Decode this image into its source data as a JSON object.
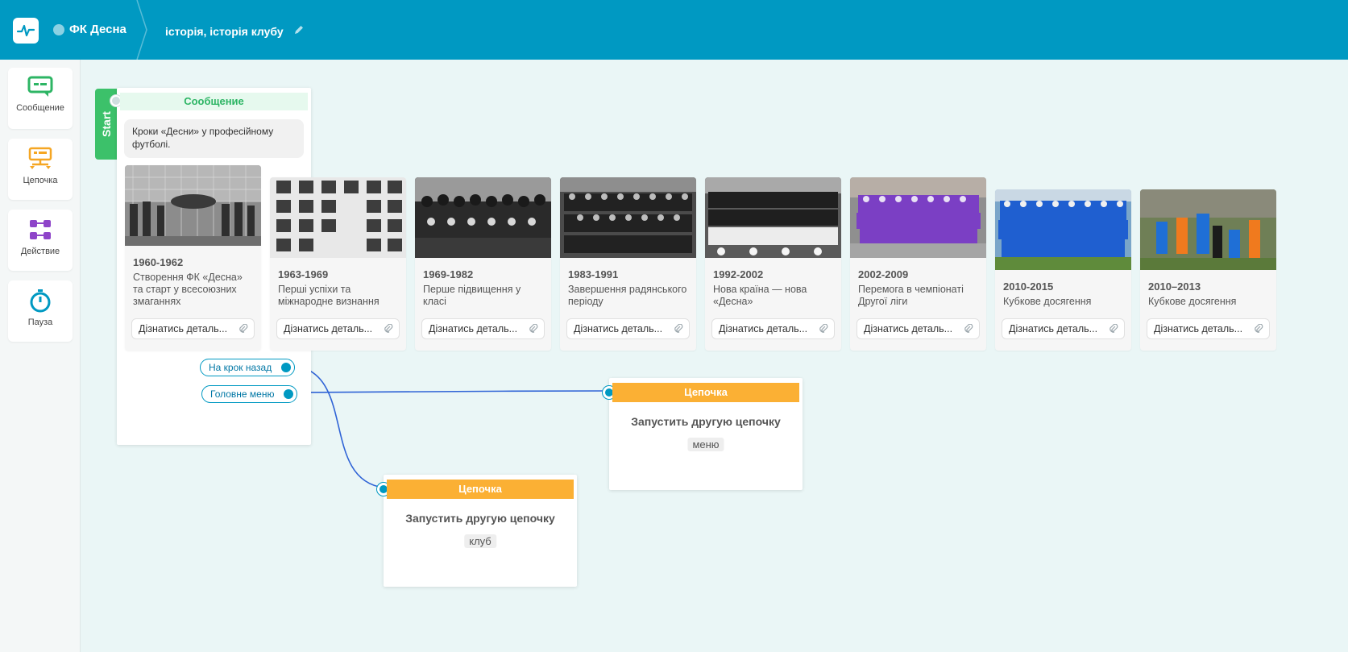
{
  "header": {
    "project_name": "ФК Десна",
    "flow_name": "історія, історія клубу"
  },
  "sidebar": {
    "items": [
      {
        "label": "Сообщение",
        "icon": "message-icon"
      },
      {
        "label": "Цепочка",
        "icon": "chain-icon"
      },
      {
        "label": "Действие",
        "icon": "action-icon"
      },
      {
        "label": "Пауза",
        "icon": "timer-icon"
      }
    ]
  },
  "canvas": {
    "start_label": "Start",
    "message_node": {
      "title": "Сообщение",
      "text": "Кроки «Десни» у професійному футболі.",
      "cards": [
        {
          "period": "1960-1962",
          "text": "Створення ФК «Десна» та старт у всесоюзних змаганнях",
          "button": "Дізнатись деталь..."
        },
        {
          "period": "1963-1969",
          "text": "Перші успіхи та міжнародне визнання",
          "button": "Дізнатись деталь..."
        },
        {
          "period": "1969-1982",
          "text": "Перше підвищення у класі",
          "button": "Дізнатись деталь..."
        },
        {
          "period": "1983-1991",
          "text": "Завершення радянського періоду",
          "button": "Дізнатись деталь..."
        },
        {
          "period": "1992-2002",
          "text": "Нова країна — нова «Десна»",
          "button": "Дізнатись деталь..."
        },
        {
          "period": "2002-2009",
          "text": "Перемога в чемпіонаті Другої ліги",
          "button": "Дізнатись деталь..."
        },
        {
          "period": "2010-2015",
          "text": "Кубкове досягення",
          "button": "Дізнатись деталь..."
        },
        {
          "period": "2010–2013",
          "text": "Кубкове досягення",
          "button": "Дізнатись деталь..."
        }
      ],
      "quick_replies": [
        {
          "label": "На крок назад"
        },
        {
          "label": "Головне меню"
        }
      ]
    },
    "chain_nodes": [
      {
        "title": "Цепочка",
        "action": "Запустить другую цепочку",
        "tag": "меню"
      },
      {
        "title": "Цепочка",
        "action": "Запустить другую цепочку",
        "tag": "клуб"
      }
    ]
  },
  "colors": {
    "header": "#0099c2",
    "canvas": "#eaf6f6",
    "start": "#3cc16a",
    "chain": "#fbb034",
    "link": "#2f63d6"
  }
}
